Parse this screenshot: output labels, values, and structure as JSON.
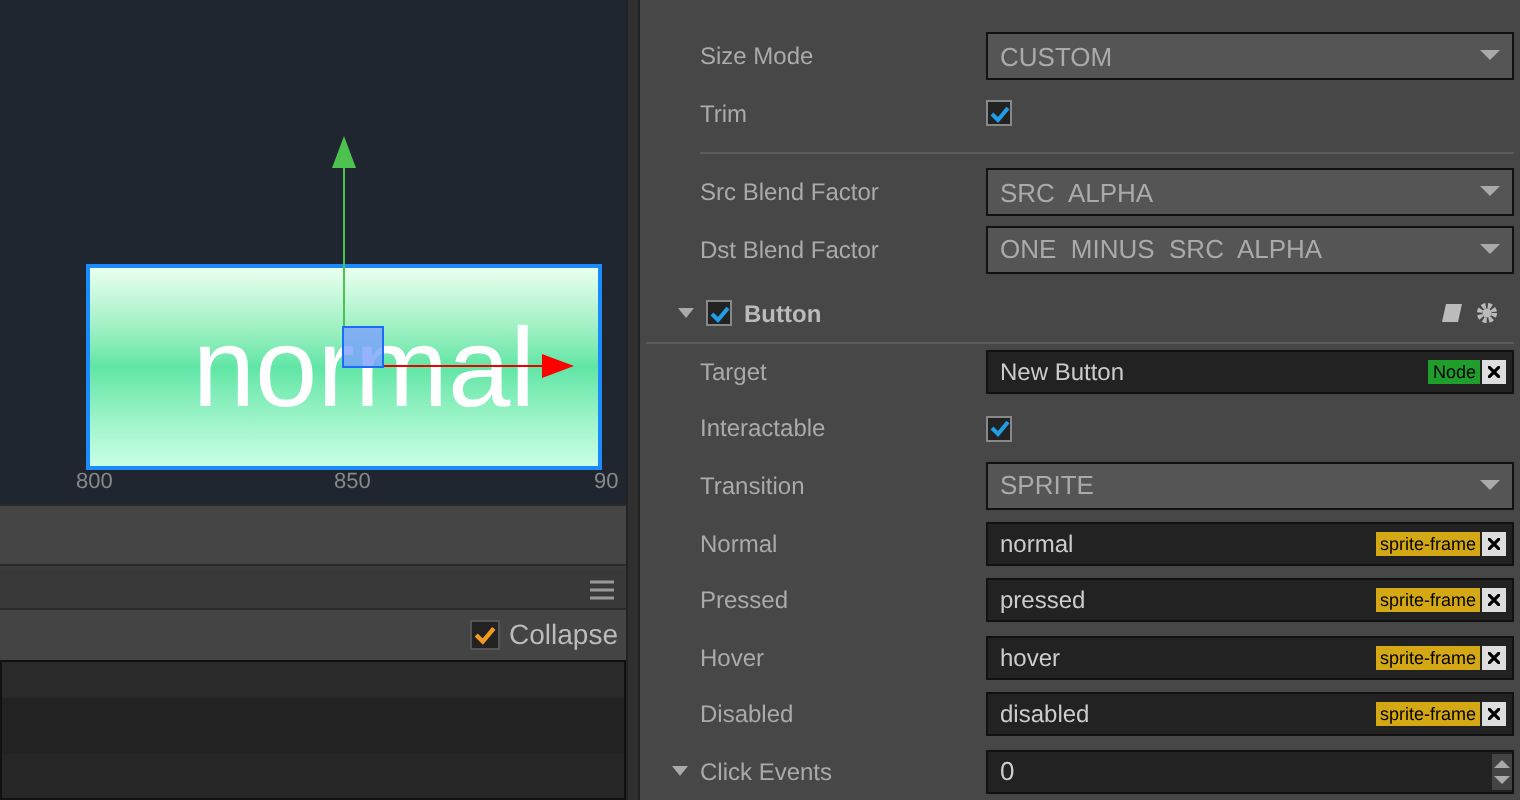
{
  "scene": {
    "sprite_label": "normal",
    "ruler": [
      "800",
      "850",
      "90"
    ]
  },
  "console": {
    "collapse": {
      "label": "Collapse",
      "checked": true
    }
  },
  "inspector": {
    "rows": [
      {
        "kind": "select",
        "label": "Size Mode",
        "value": "CUSTOM"
      },
      {
        "kind": "checkbox",
        "label": "Trim",
        "checked": true
      },
      {
        "kind": "divider"
      },
      {
        "kind": "select",
        "label": "Src Blend Factor",
        "value": "SRC  ALPHA"
      },
      {
        "kind": "select",
        "label": "Dst Blend Factor",
        "value": "ONE  MINUS  SRC  ALPHA"
      }
    ],
    "component": {
      "name": "Button",
      "enabled": true,
      "expanded": true
    },
    "component_rows": [
      {
        "kind": "asset",
        "label": "Target",
        "value": "New Button",
        "tag": "Node",
        "color": "#1f9e2c"
      },
      {
        "kind": "checkbox",
        "label": "Interactable",
        "checked": true
      },
      {
        "kind": "select",
        "label": "Transition",
        "value": "SPRITE"
      },
      {
        "kind": "asset",
        "label": "Normal",
        "value": "normal",
        "tag": "sprite-frame",
        "color": "#d4a814"
      },
      {
        "kind": "asset",
        "label": "Pressed",
        "value": "pressed",
        "tag": "sprite-frame",
        "color": "#d4a814"
      },
      {
        "kind": "asset",
        "label": "Hover",
        "value": "hover",
        "tag": "sprite-frame",
        "color": "#d4a814"
      },
      {
        "kind": "asset",
        "label": "Disabled",
        "value": "disabled",
        "tag": "sprite-frame",
        "color": "#d4a814"
      },
      {
        "kind": "number",
        "label": "Click Events",
        "value": "0",
        "expanded": true
      }
    ]
  }
}
